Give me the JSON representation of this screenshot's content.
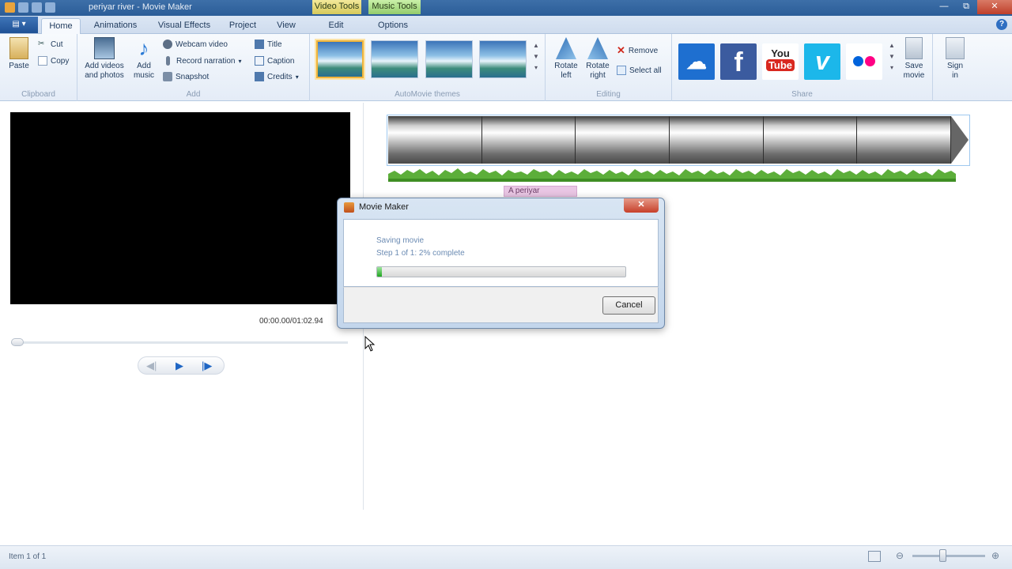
{
  "window": {
    "title": "periyar river - Movie Maker",
    "contextual_tabs": [
      "Video Tools",
      "Music Tools"
    ]
  },
  "tabs": [
    "Home",
    "Animations",
    "Visual Effects",
    "Project",
    "View",
    "Edit",
    "Options"
  ],
  "active_tab": "Home",
  "ribbon": {
    "clipboard": {
      "label": "Clipboard",
      "paste": "Paste",
      "cut": "Cut",
      "copy": "Copy"
    },
    "add": {
      "label": "Add",
      "add_videos_line1": "Add videos",
      "add_videos_line2": "and photos",
      "add_music_line1": "Add",
      "add_music_line2": "music",
      "webcam_video": "Webcam video",
      "record_narration": "Record narration",
      "snapshot": "Snapshot",
      "title": "Title",
      "caption": "Caption",
      "credits": "Credits"
    },
    "themes": {
      "label": "AutoMovie themes"
    },
    "editing": {
      "label": "Editing",
      "rotate_left_line1": "Rotate",
      "rotate_left_line2": "left",
      "rotate_right_line1": "Rotate",
      "rotate_right_line2": "right",
      "remove": "Remove",
      "select_all": "Select all"
    },
    "share": {
      "label": "Share",
      "save_movie_line1": "Save",
      "save_movie_line2": "movie",
      "sign_in_line1": "Sign",
      "sign_in_line2": "in",
      "services": [
        {
          "name": "onedrive-icon",
          "color": "#1e6fd0"
        },
        {
          "name": "facebook-icon",
          "color": "#3b5b9f",
          "glyph": "f"
        },
        {
          "name": "youtube-icon",
          "color": "#ffffff",
          "glyph_top": "You",
          "glyph_bottom": "Tube"
        },
        {
          "name": "vimeo-icon",
          "color": "#1cb7ea",
          "glyph": "v"
        },
        {
          "name": "flickr-icon",
          "color": "#ffffff"
        }
      ]
    }
  },
  "preview": {
    "timecode": "00:00.00/01:02.94"
  },
  "storyboard": {
    "caption_tag": "A periyar"
  },
  "dialog": {
    "title": "Movie Maker",
    "line1": "Saving movie",
    "line2": "Step 1 of 1: 2% complete",
    "progress_percent": 2,
    "cancel": "Cancel"
  },
  "statusbar": {
    "text": "Item 1 of 1"
  }
}
